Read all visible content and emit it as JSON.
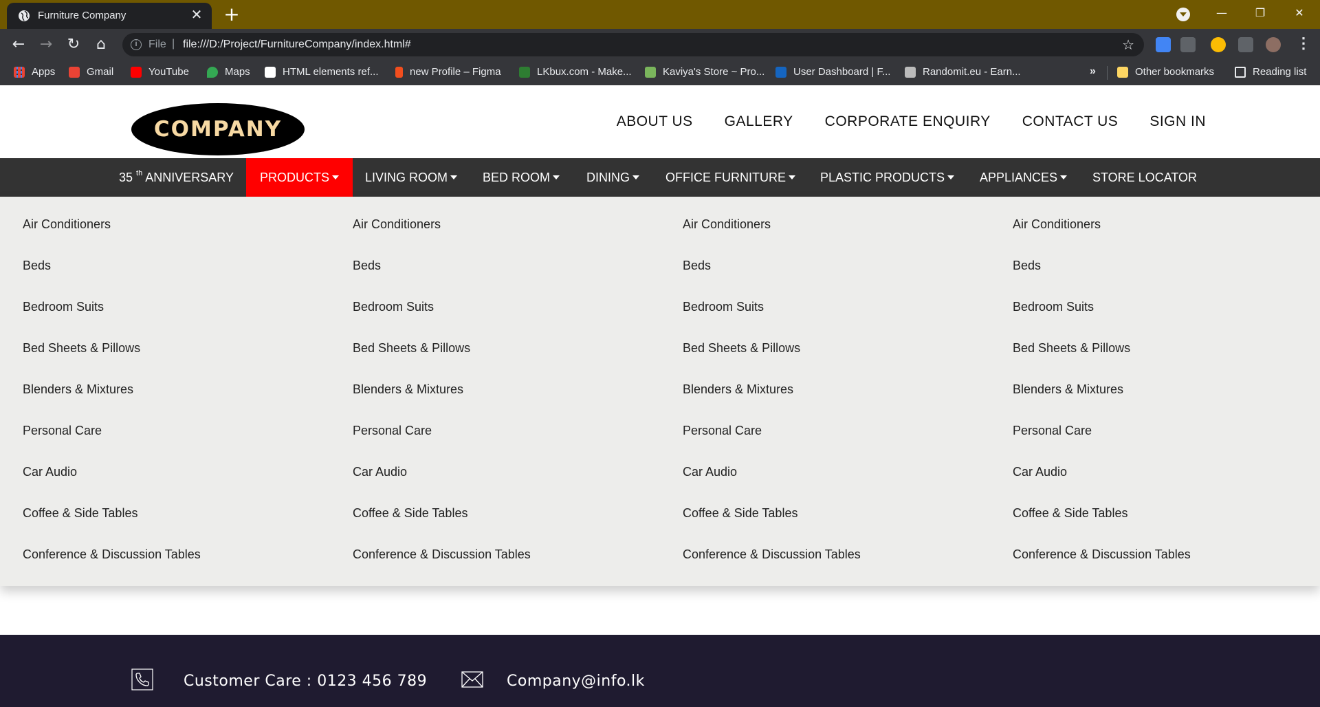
{
  "browser": {
    "tab_title": "Furniture Company",
    "tab_close": "✕",
    "new_tab": "+",
    "url_scheme": "File",
    "url_separator": "|",
    "url": "file:///D:/Project/FurnitureCompany/index.html#",
    "window_controls": {
      "minimize": "—",
      "restore": "❐",
      "close": "✕"
    },
    "bookmarks": [
      {
        "label": "Apps",
        "icon": "apps-grid-icon",
        "color": "#ea4335"
      },
      {
        "label": "Gmail",
        "icon": "gmail-icon",
        "color": "#ea4335"
      },
      {
        "label": "YouTube",
        "icon": "youtube-icon",
        "color": "#ff0000"
      },
      {
        "label": "Maps",
        "icon": "maps-icon",
        "color": "#34a853"
      },
      {
        "label": "HTML elements ref...",
        "icon": "html-ref-icon",
        "color": "#ffffff"
      },
      {
        "label": "new Profile – Figma",
        "icon": "figma-icon",
        "color": "#f24e1e"
      },
      {
        "label": "LKbux.com - Make...",
        "icon": "lkbux-icon",
        "color": "#2e7d32"
      },
      {
        "label": "Kaviya's Store ~ Pro...",
        "icon": "shopify-icon",
        "color": "#7ab55c"
      },
      {
        "label": "User Dashboard | F...",
        "icon": "fp-icon",
        "color": "#1565c0"
      },
      {
        "label": "Randomit.eu - Earn...",
        "icon": "randomit-icon",
        "color": "#bbbbbb"
      }
    ],
    "bookmarks_more": "»",
    "other_bookmarks": "Other bookmarks",
    "reading_list": "Reading list"
  },
  "site": {
    "logo_text": "COMPANY",
    "top_links": [
      "ABOUT US",
      "GALLERY",
      "CORPORATE ENQUIRY",
      "CONTACT US",
      "SIGN IN"
    ],
    "anniversary": {
      "number": "35",
      "sup": "th",
      "text": "ANNIVERSARY"
    },
    "nav": [
      {
        "label": "PRODUCTS",
        "dropdown": true,
        "active": true
      },
      {
        "label": "LIVING ROOM",
        "dropdown": true
      },
      {
        "label": "BED ROOM",
        "dropdown": true
      },
      {
        "label": "DINING",
        "dropdown": true
      },
      {
        "label": "OFFICE FURNITURE",
        "dropdown": true
      },
      {
        "label": "PLASTIC PRODUCTS",
        "dropdown": true
      },
      {
        "label": "APPLIANCES",
        "dropdown": true
      },
      {
        "label": "STORE LOCATOR",
        "dropdown": false
      }
    ],
    "mega_menu_items": [
      "Air Conditioners",
      "Beds",
      "Bedroom Suits",
      "Bed Sheets & Pillows",
      "Blenders & Mixtures",
      "Personal Care",
      "Car Audio",
      "Coffee & Side Tables",
      "Conference & Discussion Tables"
    ],
    "footer": {
      "customer_care": "Customer Care : 0123 456 789",
      "email": "Company@info.lk"
    },
    "colors": {
      "nav_bg": "#333333",
      "active": "#ff0000",
      "footer_bg": "#1f1b30",
      "menu_bg": "#ededeb"
    }
  }
}
